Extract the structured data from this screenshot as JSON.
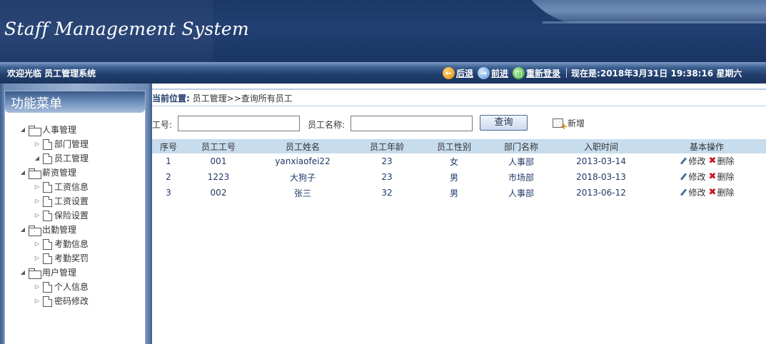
{
  "header": {
    "title": "Staff Management System"
  },
  "infobar": {
    "welcome": "欢迎光临 员工管理系统",
    "back_label": "后退",
    "forward_label": "前进",
    "relogin_label": "重新登录",
    "current_time": "现在是:2018年3月31日 19:38:16 星期六"
  },
  "sidebar": {
    "title": "功能菜单",
    "groups": [
      {
        "label": "人事管理",
        "items": [
          "部门管理",
          "员工管理"
        ]
      },
      {
        "label": "薪资管理",
        "items": [
          "工资信息",
          "工资设置",
          "保险设置"
        ]
      },
      {
        "label": "出勤管理",
        "items": [
          "考勤信息",
          "考勤奖罚"
        ]
      },
      {
        "label": "用户管理",
        "items": [
          "个人信息",
          "密码修改"
        ]
      }
    ]
  },
  "breadcrumb": {
    "label": "当前位置:",
    "path": "员工管理>>查询所有员工"
  },
  "search": {
    "id_label": "工号:",
    "id_value": "",
    "name_label": "员工名称:",
    "name_value": "",
    "query_label": "查询",
    "add_label": "新增"
  },
  "table": {
    "columns": [
      "序号",
      "员工工号",
      "员工姓名",
      "员工年龄",
      "员工性别",
      "部门名称",
      "入职时间",
      "基本操作"
    ],
    "rows": [
      [
        "1",
        "001",
        "yanxiaofei22",
        "23",
        "女",
        "人事部",
        "2013-03-14"
      ],
      [
        "2",
        "1223",
        "大狗子",
        "23",
        "男",
        "市场部",
        "2018-03-13"
      ],
      [
        "3",
        "002",
        "张三",
        "32",
        "男",
        "人事部",
        "2013-06-12"
      ]
    ],
    "edit_label": "修改",
    "delete_label": "删除"
  }
}
